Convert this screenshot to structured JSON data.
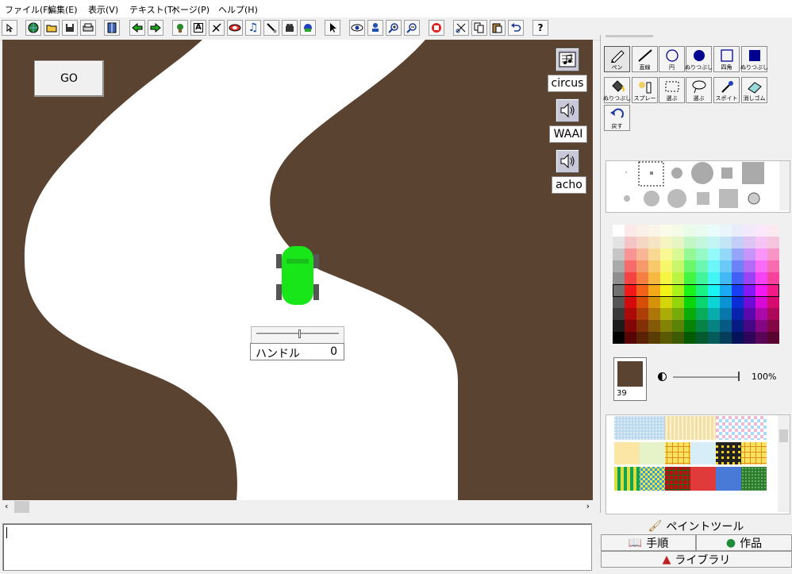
{
  "menu": [
    "ファイル(F)",
    "編集(E)",
    "表示(V)",
    "テキスト(T)",
    "ページ(P)",
    "ヘルプ(H)"
  ],
  "toolbar_icons": [
    "cursor-small-icon",
    "globe-icon",
    "open-folder-icon",
    "save-icon",
    "print-icon",
    "layout-icon",
    "back-arrow-icon",
    "forward-arrow-icon",
    "plant-icon",
    "text-tool-icon",
    "link-tool-icon",
    "bridge-icon",
    "note-icon",
    "brush-icon",
    "camera-icon",
    "shape-icon",
    "arrow-select-icon",
    "eye-icon",
    "stamp-icon",
    "zoom-in-icon",
    "zoom-out-icon",
    "hand-stop-icon",
    "cut-icon",
    "copy-icon",
    "paste-icon",
    "undo-icon",
    "help-icon"
  ],
  "stage": {
    "bg_color": "#5b4331",
    "road_color": "#ffffff",
    "car_color": "#19e619",
    "go_button": "GO",
    "sounds": [
      {
        "icon": "music-note-icon",
        "label": "circus"
      },
      {
        "icon": "speaker-icon",
        "label": "WAAI"
      },
      {
        "icon": "speaker-icon",
        "label": "acho"
      }
    ],
    "handle_label": "ハンドル",
    "handle_value": "0",
    "handle_slider_fraction": 0.5
  },
  "paint_tools": [
    {
      "name": "pen-tool",
      "label": "ペン",
      "selected": true
    },
    {
      "name": "line-tool",
      "label": "直線"
    },
    {
      "name": "circle-tool",
      "label": "円"
    },
    {
      "name": "filled-circle-tool",
      "label": "ぬりつぶし"
    },
    {
      "name": "rect-tool",
      "label": "四角"
    },
    {
      "name": "filled-rect-tool",
      "label": "ぬりつぶし"
    },
    {
      "name": "fill-tool",
      "label": "ぬりつぶし"
    },
    {
      "name": "spray-tool",
      "label": "スプレー"
    },
    {
      "name": "select-rect-tool",
      "label": "選ぶ"
    },
    {
      "name": "select-lasso-tool",
      "label": "選ぶ"
    },
    {
      "name": "eyedropper-tool",
      "label": "スポイト"
    },
    {
      "name": "eraser-tool",
      "label": "消しゴム"
    },
    {
      "name": "undo-tool",
      "label": "戻す"
    }
  ],
  "color_swatch": {
    "value": "39",
    "color": "#5b4331"
  },
  "opacity": "100%",
  "panel_tabs": {
    "paint": "ペイントツール",
    "steps": "手順",
    "works": "作品",
    "library": "ライブラリ"
  }
}
